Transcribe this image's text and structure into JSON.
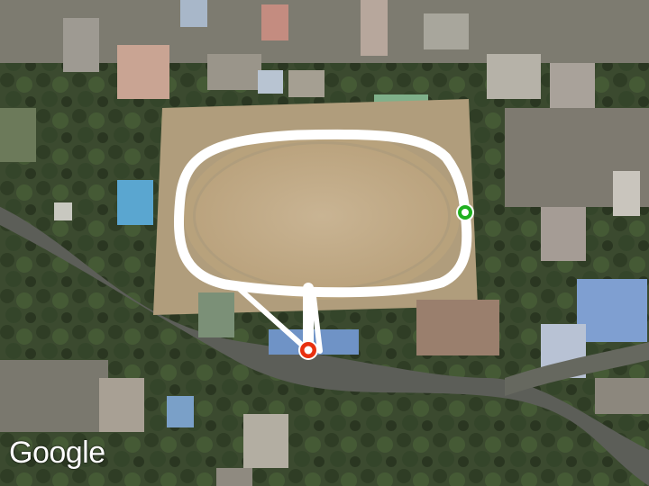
{
  "map": {
    "type": "satellite",
    "attribution_logo": "Google"
  },
  "route": {
    "color": "#ffffff",
    "start_marker": {
      "icon": "start-marker-icon",
      "color": "#20b020"
    },
    "end_marker": {
      "icon": "end-marker-icon",
      "color": "#e83010"
    }
  },
  "colors": {
    "track": "#c8b38e",
    "vegetation": "#36452b",
    "road": "#6a6c66"
  }
}
